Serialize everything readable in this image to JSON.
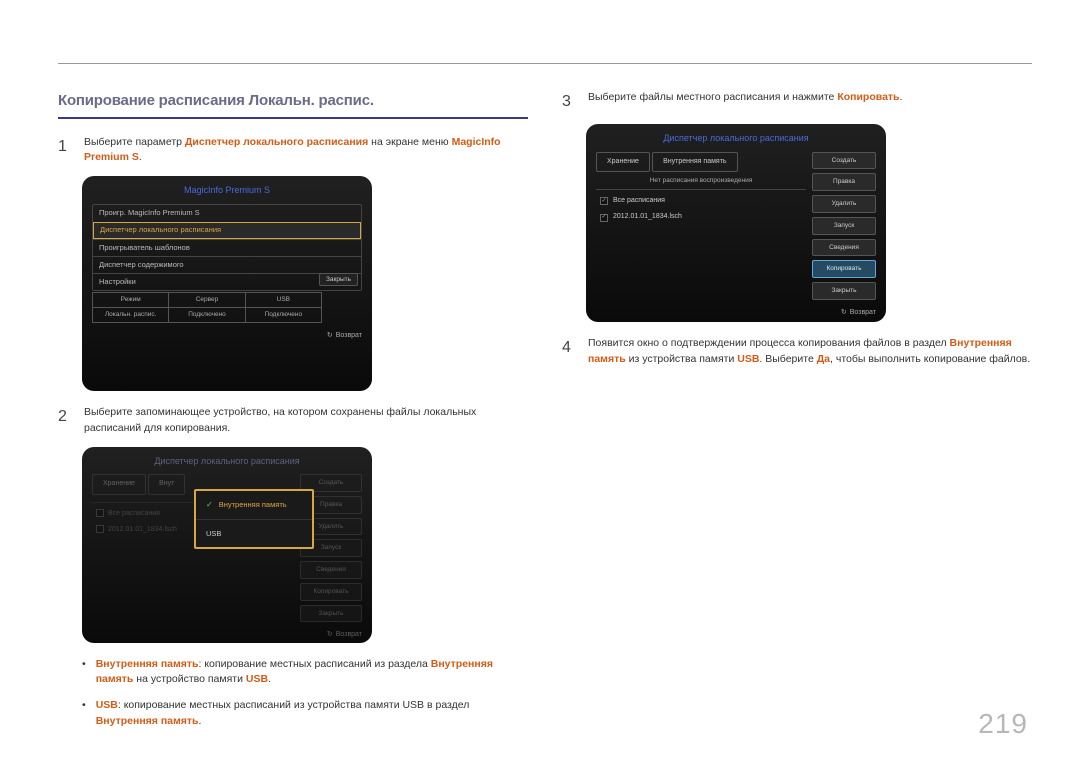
{
  "page_number": "219",
  "heading": "Копирование расписания Локальн. распис.",
  "step1": {
    "num": "1",
    "pre": "Выберите параметр ",
    "hl1": "Диспетчер локального расписания",
    "mid": " на экране меню ",
    "hl2": "MagicInfo Premium S",
    "post": "."
  },
  "ss1": {
    "title": "MagicInfo Premium S",
    "items": [
      "Проигр. MagicInfo Premium S",
      "Диспетчер локального расписания",
      "Проигрыватель шаблонов",
      "Диспетчер содержимого",
      "Настройки"
    ],
    "close": "Закрыть",
    "status_headers": [
      "Режим",
      "Сервер",
      "USB"
    ],
    "status_values": [
      "Локальн. распис.",
      "Подключено",
      "Подключено"
    ],
    "return": "Возврат"
  },
  "step2": {
    "num": "2",
    "text": "Выберите запоминающее устройство, на котором сохранены файлы локальных расписаний для копирования."
  },
  "ss2": {
    "title": "Диспетчер локального расписания",
    "storage": "Хранение",
    "internal_slot": "Внут",
    "popup": {
      "opt1": "Внутренняя память",
      "opt2": "USB"
    },
    "rows": [
      "Все расписания",
      "2012.01.01_1834.lsch"
    ],
    "buttons": [
      "Создать",
      "Правка",
      "Удалить",
      "Запуск",
      "Сведения",
      "Копировать",
      "Закрыть"
    ],
    "return": "Возврат"
  },
  "step3": {
    "num": "3",
    "pre": "Выберите файлы местного расписания и нажмите ",
    "hl": "Копировать",
    "post": "."
  },
  "ss3": {
    "title": "Диспетчер локального расписания",
    "storage": "Хранение",
    "internal": "Внутренняя память",
    "sub": "Нет расписания воспроизведения",
    "rows": [
      "Все расписания",
      "2012.01.01_1834.lsch"
    ],
    "buttons": [
      "Создать",
      "Правка",
      "Удалить",
      "Запуск",
      "Сведения",
      "Копировать",
      "Закрыть"
    ],
    "return": "Возврат"
  },
  "step4": {
    "num": "4",
    "t1": "Появится окно о подтверждении процесса копирования файлов в раздел ",
    "hl1": "Внутренняя память",
    "t2": " из устройства памяти ",
    "hl2": "USB",
    "t3": ". Выберите ",
    "hl3": "Да",
    "t4": ", чтобы выполнить копирование файлов."
  },
  "bullets": {
    "b1": {
      "hl1": "Внутренняя память",
      "t1": ": копирование местных расписаний из раздела ",
      "hl2": "Внутренняя память",
      "t2": " на устройство памяти ",
      "hl3": "USB",
      "t3": "."
    },
    "b2": {
      "hl1": "USB",
      "t1": ": копирование местных расписаний из устройства памяти USB в раздел ",
      "hl2": "Внутренняя память",
      "t2": "."
    }
  }
}
